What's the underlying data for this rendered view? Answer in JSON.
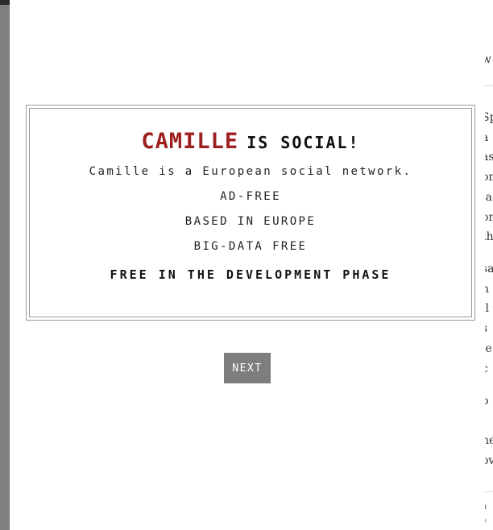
{
  "background_page": {
    "fragments": [
      "w",
      "Sp",
      "a",
      "as",
      "on",
      "-a",
      "on",
      "th",
      "sa",
      "n",
      "ll",
      "s",
      "le",
      "c",
      "o",
      ".",
      "ne",
      "ov",
      "h",
      "e"
    ]
  },
  "modal": {
    "headline": {
      "brand": "CAMILLE",
      "rest": "IS SOCIAL!"
    },
    "intro": "Camille is a European social network.",
    "features": [
      "AD-FREE",
      "BASED IN EUROPE",
      "BIG-DATA FREE"
    ],
    "emphasis": "FREE IN THE DEVELOPMENT PHASE",
    "next_label": "NEXT"
  },
  "colors": {
    "brand": "#9e1f1f",
    "overlay": "#7f7f7f",
    "button": "#7d7d7d"
  }
}
